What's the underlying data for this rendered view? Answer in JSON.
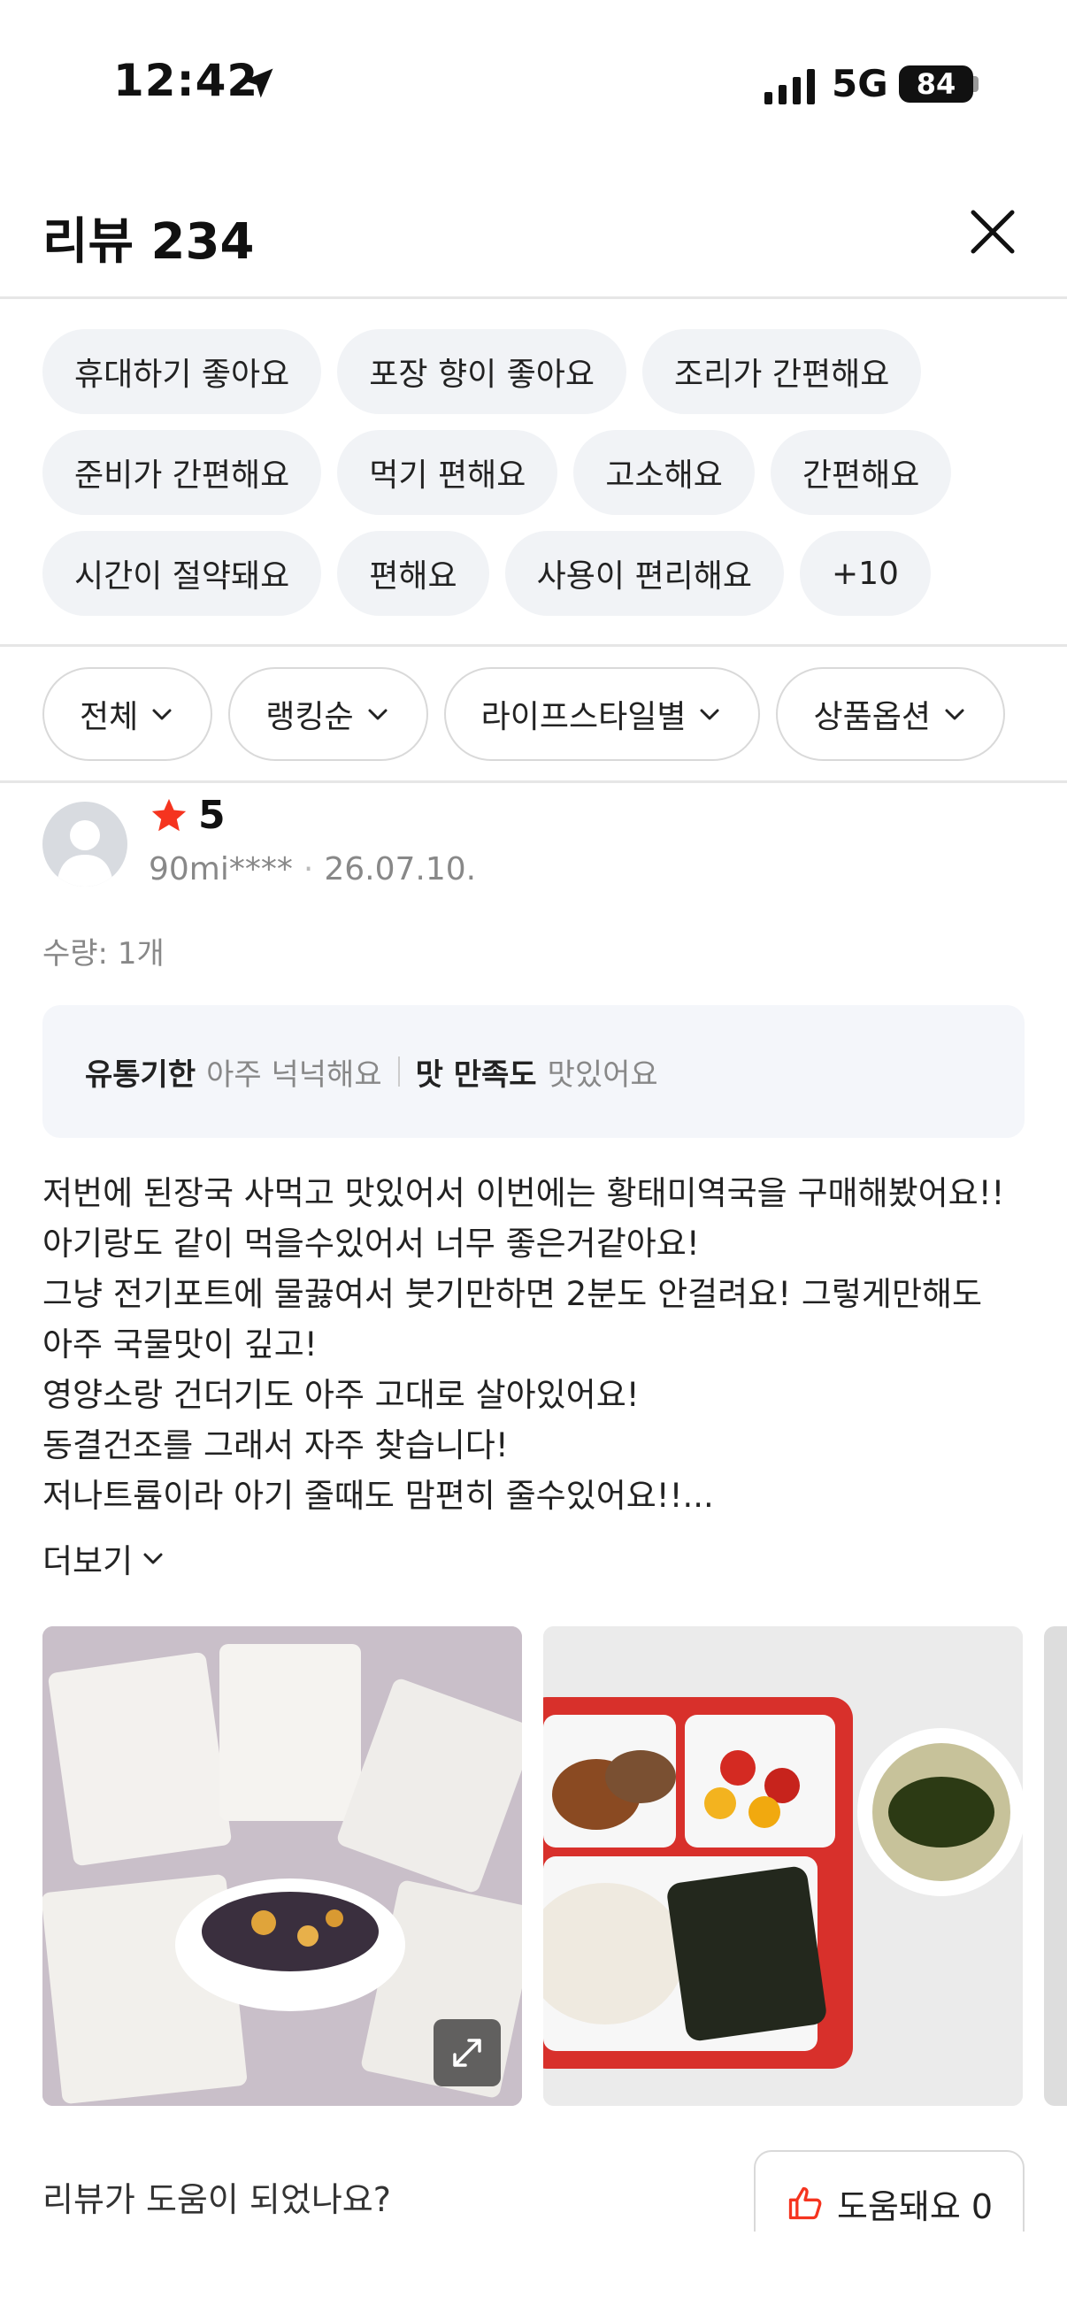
{
  "status_bar": {
    "time": "12:42",
    "network": "5G",
    "battery": "84"
  },
  "header": {
    "title": "리뷰 234"
  },
  "tags": [
    [
      "휴대하기 좋아요",
      "포장 향이 좋아요",
      "조리가 간편해요"
    ],
    [
      "준비가 간편해요",
      "먹기 편해요",
      "고소해요",
      "간편해요"
    ],
    [
      "시간이 절약돼요",
      "편해요",
      "사용이 편리해요",
      "+10"
    ]
  ],
  "filters": [
    "전체",
    "랭킹순",
    "라이프스타일별",
    "상품옵션"
  ],
  "review": {
    "rating": "5",
    "user": "90mi****",
    "date": "26.07.10.",
    "quantity": "수량: 1개",
    "evaluations": [
      {
        "key": "유통기한",
        "value": "아주 넉넉해요"
      },
      {
        "key": "맛 만족도",
        "value": "맛있어요"
      }
    ],
    "body_lines": [
      "저번에 된장국 사먹고 맛있어서 이번에는 황태미역국을 구매해봤어요!!",
      "아기랑도 같이 먹을수있어서 너무 좋은거같아요!",
      "그냥 전기포트에 물끓여서 붓기만하면 2분도 안걸려요! 그렇게만해도",
      "아주 국물맛이 깊고!",
      "영양소랑 건더기도 아주 고대로 살아있어요!",
      "동결건조를 그래서 자주 찾습니다!",
      "저나트륨이라 아기 줄때도 맘편히 줄수있어요!!..."
    ],
    "more_label": "더보기",
    "helpful_question": "리뷰가 도움이 되었나요?",
    "helpful_label": "도움돼요 0"
  },
  "colors": {
    "star": "#f5341f",
    "chip_bg": "#f1f3f6",
    "divider": "#e6e6e6"
  }
}
